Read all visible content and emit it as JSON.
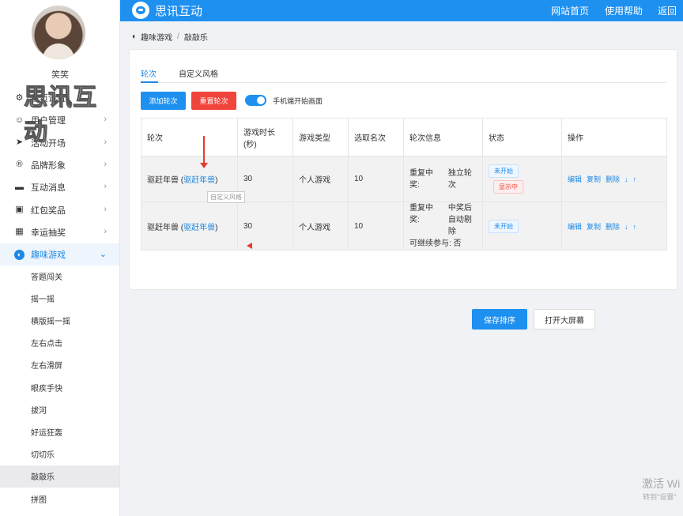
{
  "user": {
    "name": "笑笑"
  },
  "watermark": "思讯互动",
  "sidebar": {
    "menu": [
      {
        "label": "首页设置",
        "icon": "gear-icon",
        "glyph": "⚙",
        "chev": ""
      },
      {
        "label": "用户管理",
        "icon": "user-icon",
        "glyph": "☺",
        "chev": "›"
      },
      {
        "label": "活动开场",
        "icon": "paper-plane-icon",
        "glyph": "➤",
        "chev": "›"
      },
      {
        "label": "品牌形象",
        "icon": "registered-icon",
        "glyph": "®",
        "chev": "›"
      },
      {
        "label": "互动消息",
        "icon": "chat-icon",
        "glyph": "▬",
        "chev": "›"
      },
      {
        "label": "红包奖品",
        "icon": "gift-icon",
        "glyph": "▣",
        "chev": "›"
      },
      {
        "label": "幸运抽奖",
        "icon": "lottery-icon",
        "glyph": "▦",
        "chev": "›"
      },
      {
        "label": "趣味游戏",
        "icon": "game-icon",
        "glyph": "◐",
        "chev": "⌄"
      }
    ],
    "submenu": [
      "答题闯关",
      "摇一摇",
      "横版摇一摇",
      "左右点击",
      "左右滑屏",
      "眼疾手快",
      "拔河",
      "好运狂轰",
      "切切乐",
      "敲敲乐",
      "拼图"
    ]
  },
  "topbar": {
    "title": "思讯互动",
    "links": [
      "网站首页",
      "使用帮助",
      "返回"
    ]
  },
  "breadcrumb": {
    "parent": "趣味游戏",
    "sep": "/",
    "current": "敲敲乐"
  },
  "tabs": [
    "轮次",
    "自定义风格"
  ],
  "toolbar": {
    "add": "添加轮次",
    "reset": "重置轮次",
    "toggle_label": "手机端开始画面"
  },
  "table": {
    "headers": [
      "轮次",
      "游戏时长\n(秒)",
      "游戏类型",
      "选取名次",
      "轮次信息",
      "状态",
      "操作"
    ],
    "rows": [
      {
        "name": "驱赶年兽",
        "link": "驱赶年兽",
        "duration": "30",
        "type": "个人游戏",
        "rank": "10",
        "info": [
          "重复中奖:",
          "独立轮次",
          "",
          ""
        ],
        "status": [
          "未开始",
          "显示中"
        ]
      },
      {
        "name": "驱赶年兽",
        "link": "驱赶年兽",
        "duration": "30",
        "type": "个人游戏",
        "rank": "10",
        "info": [
          "重复中奖:",
          "中奖后自动剔除",
          "可继续参与: 否",
          ""
        ],
        "status": [
          "未开始"
        ]
      }
    ],
    "ops": [
      "编辑",
      "复制",
      "删除",
      "↓",
      "↑"
    ]
  },
  "tooltip": "自定义风格",
  "footer": {
    "save": "保存排序",
    "screen": "打开大屏幕"
  },
  "activation": {
    "line1": "激活 Wi",
    "line2": "转到\"设置\""
  }
}
